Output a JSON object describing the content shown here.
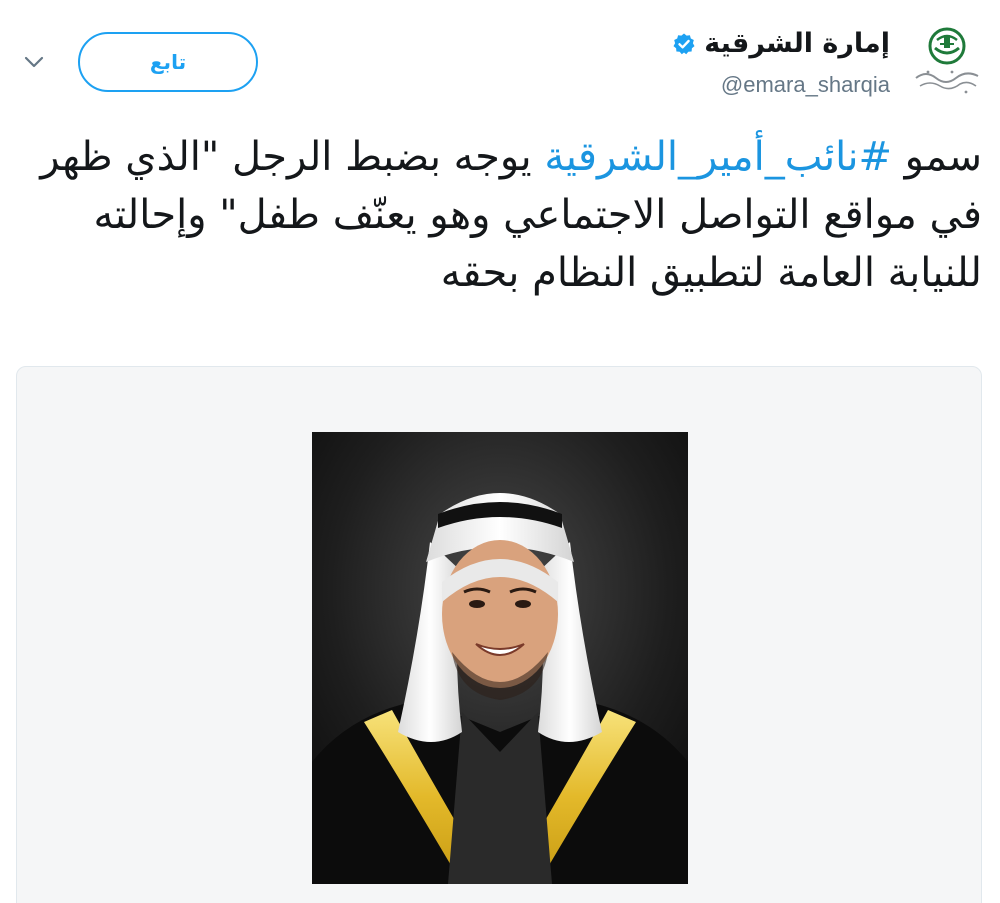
{
  "header": {
    "account_name": "إمارة الشرقية",
    "handle": "@emara_sharqia",
    "follow_label": "تابع",
    "chevron_icon": "chevron-down-icon",
    "verified_icon": "verified-badge-icon",
    "logo_icon": "emirate-emblem-logo"
  },
  "tweet": {
    "text_before": "سمو ",
    "hashtag": "#نائب_أمير_الشرقية",
    "text_after": " يوجه بضبط الرجل \"الذي ظهر في مواقع التواصل الاجتماعي وهو يعنّف طفل\" وإحالته للنيابة العامة لتطبيق النظام بحقه"
  },
  "media": {
    "photo": "portrait-photo"
  },
  "colors": {
    "accent": "#1da1f2",
    "hashtag": "#1b95e0",
    "text": "#14171a",
    "muted": "#657786",
    "card_bg": "#f5f6f7",
    "emblem_green": "#1f7a3a"
  }
}
